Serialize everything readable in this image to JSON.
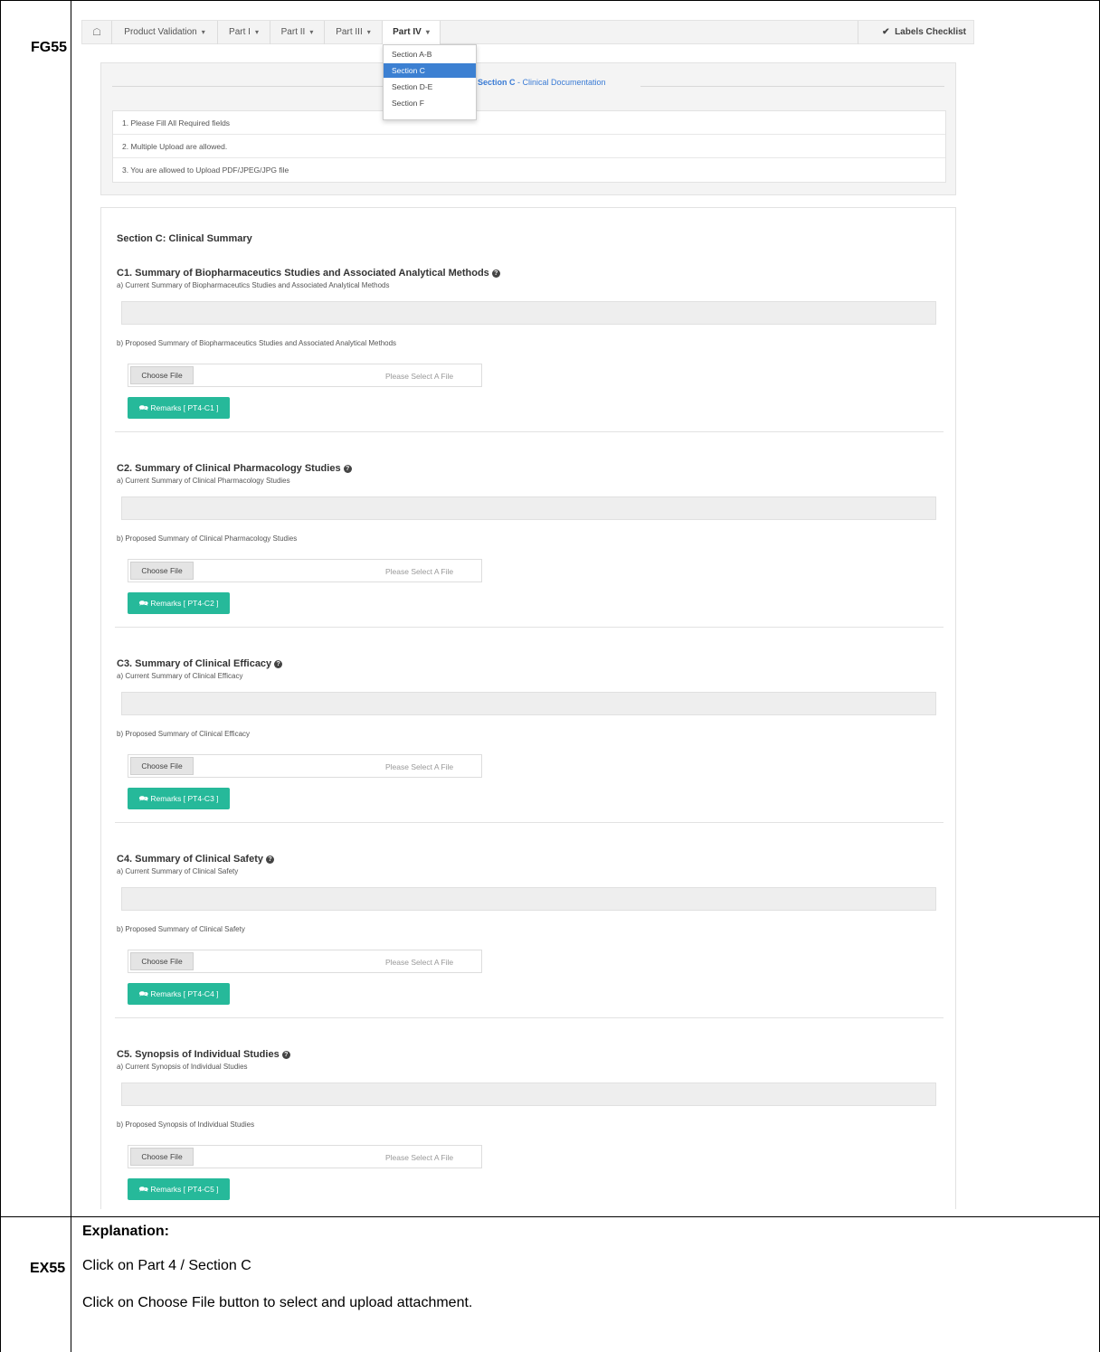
{
  "rows": {
    "fg_label": "FG55",
    "ex_label": "EX55"
  },
  "navbar": {
    "home_icon": "home-icon",
    "items": [
      {
        "label": "Product Validation"
      },
      {
        "label": "Part I"
      },
      {
        "label": "Part II"
      },
      {
        "label": "Part III"
      },
      {
        "label": "Part IV"
      }
    ],
    "caret": "▾",
    "right_check": "✔",
    "right_label": "Labels Checklist"
  },
  "dropdown": {
    "items": [
      "Section A-B",
      "Section C",
      "Section D-E",
      "Section F"
    ],
    "active": "Section C"
  },
  "legend": {
    "strong": "Section C",
    "rest": " - Clinical Documentation"
  },
  "notes": [
    "1. Please Fill All Required fields",
    "2. Multiple Upload are allowed.",
    "3. You are allowed to Upload PDF/JPEG/JPG file"
  ],
  "section_title": "Section C: Clinical Summary",
  "blocks": [
    {
      "title": "C1. Summary of Biopharmaceutics Studies and Associated Analytical Methods",
      "current": "a) Current Summary of Biopharmaceutics Studies and Associated Analytical Methods",
      "proposed": "b) Proposed Summary of Biopharmaceutics Studies and Associated Analytical Methods",
      "choose": "Choose File",
      "placeholder": "Please Select A File",
      "remarks": "Remarks [ PT4-C1 ]"
    },
    {
      "title": "C2. Summary of Clinical Pharmacology Studies",
      "current": "a) Current Summary of Clinical Pharmacology Studies",
      "proposed": "b) Proposed Summary of Clinical Pharmacology Studies",
      "choose": "Choose File",
      "placeholder": "Please Select A File",
      "remarks": "Remarks [ PT4-C2 ]"
    },
    {
      "title": "C3. Summary of Clinical Efficacy",
      "current": "a) Current Summary of Clinical Efficacy",
      "proposed": "b) Proposed Summary of Clinical Efficacy",
      "choose": "Choose File",
      "placeholder": "Please Select A File",
      "remarks": "Remarks [ PT4-C3 ]"
    },
    {
      "title": "C4. Summary of Clinical Safety",
      "current": "a) Current Summary of Clinical Safety",
      "proposed": "b) Proposed Summary of Clinical Safety",
      "choose": "Choose File",
      "placeholder": "Please Select A File",
      "remarks": "Remarks [ PT4-C4 ]"
    },
    {
      "title": "C5. Synopsis of Individual Studies",
      "current": "a) Current Synopsis of Individual Studies",
      "proposed": "b) Proposed Synopsis of Individual Studies",
      "choose": "Choose File",
      "placeholder": "Please Select A File",
      "remarks": "Remarks [ PT4-C5 ]"
    }
  ],
  "explanation": {
    "title": "Explanation:",
    "lines": [
      "Click on Part 4 / Section C",
      "Click on Choose File button to select and upload attachment."
    ]
  },
  "colors": {
    "accent": "#26b99a",
    "dropdown_active": "#3c80d2",
    "legend": "#3a7bd5"
  }
}
